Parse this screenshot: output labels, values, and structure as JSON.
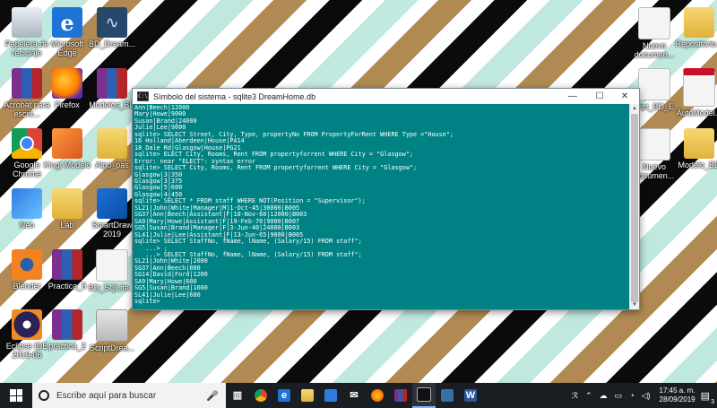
{
  "desktop_icons": [
    {
      "label": "Papelera de reciclaje",
      "icon": "recycle-bin-icon"
    },
    {
      "label": "Microsoft Edge",
      "icon": "edge-icon"
    },
    {
      "label": "BD_Dream...",
      "icon": "uml-diagram-icon"
    },
    {
      "label": "Acrobat para escrit...",
      "icon": "winrar-icon"
    },
    {
      "label": "Firefox",
      "icon": "firefox-icon"
    },
    {
      "label": "Modelos_BD",
      "icon": "winrar-icon"
    },
    {
      "label": "Google Chrome",
      "icon": "chrome-icon"
    },
    {
      "label": "Kingt Modelo",
      "icon": "cube-icon"
    },
    {
      "label": "Algo_pas",
      "icon": "folder-icon"
    },
    {
      "label": "Neo",
      "icon": "store-icon"
    },
    {
      "label": "Lab",
      "icon": "folder-icon"
    },
    {
      "label": "SmartDraw 2019",
      "icon": "smartdraw-icon"
    },
    {
      "label": "Blender",
      "icon": "blender-icon"
    },
    {
      "label": "Practica_5",
      "icon": "winrar-icon"
    },
    {
      "label": "BD_SQLite...",
      "icon": "file-icon"
    },
    {
      "label": "Eclipse IDE 2019-06",
      "icon": "eclipse-icon"
    },
    {
      "label": "practica_2",
      "icon": "winrar-icon"
    },
    {
      "label": "ScriptDrea...",
      "icon": "sql-file-icon"
    },
    {
      "label": "Nuevo documen...",
      "icon": "file-icon"
    },
    {
      "label": "Repositorio...",
      "icon": "folder-icon"
    },
    {
      "label": "Script_BD_E...",
      "icon": "file-icon"
    },
    {
      "label": "AutoModel...",
      "icon": "pdf-icon"
    },
    {
      "label": "Nuevo documen...",
      "icon": "file-icon"
    },
    {
      "label": "Modelo_BD",
      "icon": "folder-icon"
    }
  ],
  "window": {
    "title": "Símbolo del sistema - sqlite3  DreamHome.db",
    "minimize": "—",
    "maximize": "☐",
    "close": "✕",
    "console_lines": [
      "Ann|Beech|12000",
      "Mary|Howe|9000",
      "Susan|Brand|24000",
      "Julie|Lee|9000",
      "sqlite> SELECT Street, City, Type, propertyNo FROM PropertyForRent WHERE Type =\"House\";",
      "16 Holland|Aberdeen|House|PA14",
      "18 Dale Rd|Glasgow|House|PG21",
      "sqlite> ELECT City, Rooms, Rent FROM propertyforrent WHERE City = \"Glasgow\";",
      "Error: near \"ELECT\": syntax error",
      "sqlite> SELECT City, Rooms, Rent FROM propertyforrent WHERE City = \"Glasgow\";",
      "Glasgow|3|350",
      "Glasgow|3|375",
      "Glasgow|5|600",
      "Glasgow|4|450",
      "sqlite> SELECT * FROM staff WHERE NOT(Position = \"Supervisor\");",
      "SL21|John|White|Manager|M|1-Oct-45|30000|B005",
      "SG37|Ann|Beech|Assistant|F|10-Nov-60|12000|B003",
      "SA9|Mary|Howe|Assistant|F|19-Feb-70|9000|B007",
      "SG5|Susan|Brand|Manager|F|3-Jun-40|24000|B003",
      "SL41|Julie|Lee|Assistant|F|13-Jun-65|9000|B005",
      "sqlite> SELECT StaffNo, fName, lName, (Salary/15) FROM staff\";",
      "   ...> ;",
      "   ...> SELECT StaffNo, fName, lName, (Salary/15) FROM staff\";",
      "SL21|John|White|2000",
      "SG37|Ann|Beech|800",
      "SG14|David|Ford|1200",
      "SA9|Mary|Howe|600",
      "SG5|Susan|Brand|1600",
      "SL41|Julie|Lee|600",
      "sqlite>"
    ]
  },
  "taskbar": {
    "search_placeholder": "Escribe aquí para buscar",
    "time": "17:45 a. m.",
    "date": "28/09/2019",
    "notification_count": "3",
    "pinned_icons": [
      "task-view-icon",
      "chrome-icon",
      "edge-icon",
      "file-explorer-icon",
      "store-icon",
      "mail-icon",
      "firefox-icon",
      "winrar-icon",
      "terminal-icon",
      "sqlite-tool-icon",
      "word-icon"
    ]
  }
}
